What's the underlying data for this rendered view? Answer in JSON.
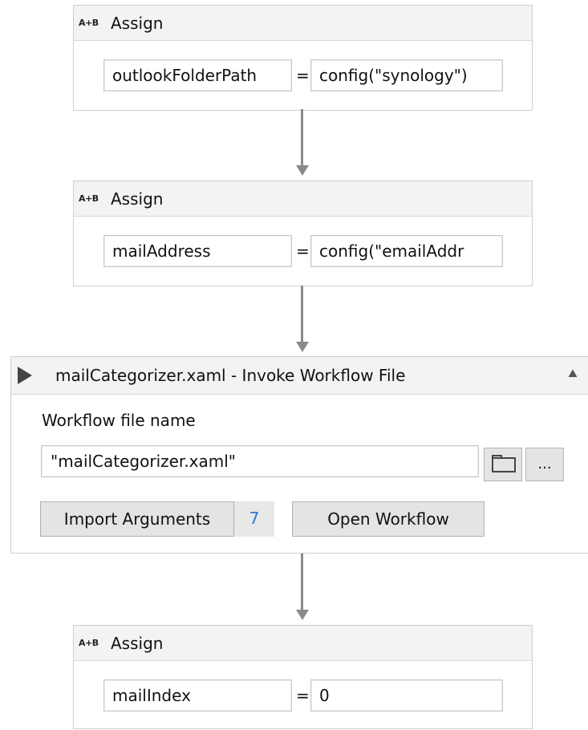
{
  "activities": {
    "assign1": {
      "icon": "A+B",
      "title": "Assign",
      "to": "outlookFolderPath",
      "equals": "=",
      "value": "config(\"synology\")"
    },
    "assign2": {
      "icon": "A+B",
      "title": "Assign",
      "to": "mailAddress",
      "equals": "=",
      "value": "config(\"emailAddr"
    },
    "invoke": {
      "title": "mailCategorizer.xaml - Invoke Workflow File",
      "collapse_icon": "collapse-up-icon",
      "file_label": "Workflow file name",
      "file_value": "\"mailCategorizer.xaml\"",
      "more_label": "...",
      "import_label": "Import Arguments",
      "arg_count": "7",
      "open_label": "Open Workflow"
    },
    "assign3": {
      "icon": "A+B",
      "title": "Assign",
      "to": "mailIndex",
      "equals": "=",
      "value": "0"
    }
  },
  "colors": {
    "header_bg": "#f3f3f3",
    "connector": "#8a8a8a",
    "count_accent": "#2b7bd6"
  }
}
